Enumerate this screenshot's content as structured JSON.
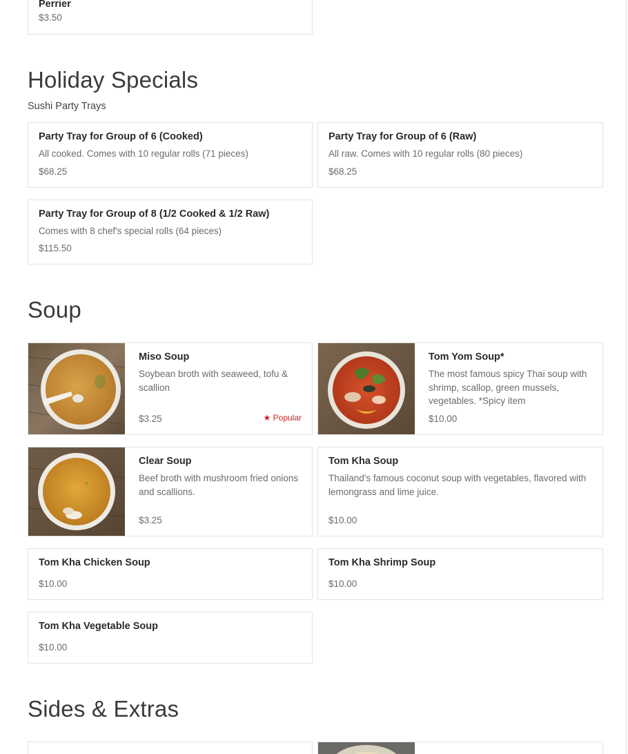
{
  "top_item": {
    "name": "Perrier",
    "price": "$3.50"
  },
  "holiday": {
    "title": "Holiday Specials",
    "subtitle": "Sushi Party Trays",
    "items": [
      {
        "name": "Party Tray for Group of 6 (Cooked)",
        "desc": "All cooked. Comes with 10 regular rolls (71 pieces)",
        "price": "$68.25"
      },
      {
        "name": "Party Tray for Group of 6 (Raw)",
        "desc": "All raw. Comes with 10 regular rolls (80 pieces)",
        "price": "$68.25"
      },
      {
        "name": "Party Tray for Group of 8 (1/2 Cooked & 1/2 Raw)",
        "desc": "Comes with 8 chef's special rolls (64 pieces)",
        "price": "$115.50"
      }
    ]
  },
  "soup": {
    "title": "Soup",
    "items": [
      {
        "name": "Miso Soup",
        "desc": "Soybean broth with seaweed, tofu & scallion",
        "price": "$3.25",
        "badge": "★ Popular"
      },
      {
        "name": "Tom Yom Soup*",
        "desc": "The most famous spicy Thai soup with shrimp, scallop, green mussels, vegetables. *Spicy item",
        "price": "$10.00"
      },
      {
        "name": "Clear Soup",
        "desc": "Beef broth with mushroom fried onions and scallions.",
        "price": "$3.25"
      },
      {
        "name": "Tom Kha Soup",
        "desc": "Thailand's famous coconut soup with vegetables, flavored with lemongrass and lime juice.",
        "price": "$10.00"
      },
      {
        "name": "Tom Kha Chicken Soup",
        "price": "$10.00"
      },
      {
        "name": "Tom Kha Shrimp Soup",
        "price": "$10.00"
      },
      {
        "name": "Tom Kha Vegetable Soup",
        "price": "$10.00"
      }
    ]
  },
  "sides": {
    "title": "Sides & Extras"
  },
  "colors": {
    "popular": "#d0201c",
    "border": "#e3e3e3",
    "muted": "#6b6b6b"
  },
  "icons": {
    "popular": "star-icon"
  }
}
